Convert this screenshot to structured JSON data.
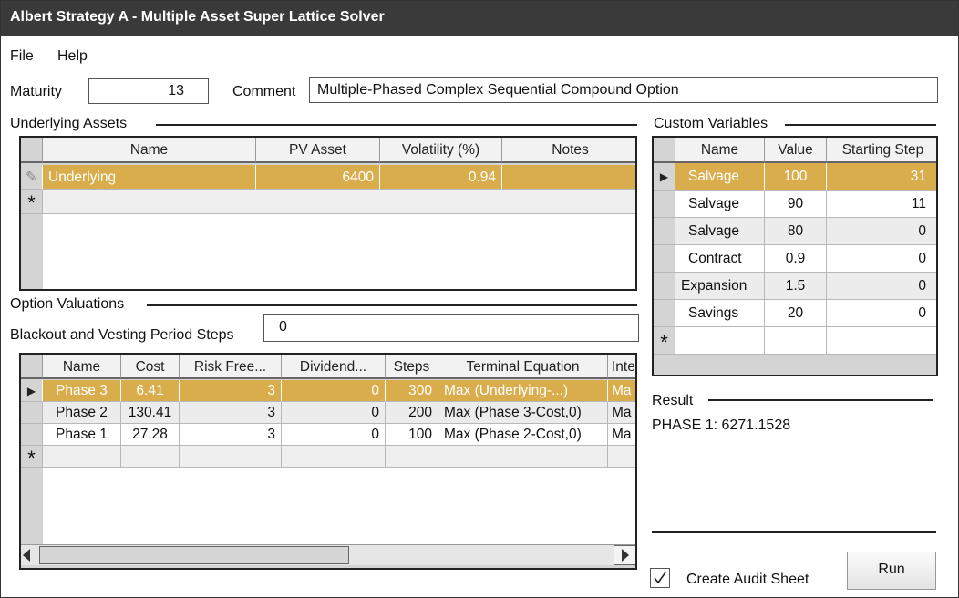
{
  "window": {
    "title": "Albert Strategy A - Multiple Asset Super Lattice Solver"
  },
  "menu": {
    "file": "File",
    "help": "Help"
  },
  "maturity": {
    "label": "Maturity",
    "value": "13"
  },
  "comment": {
    "label": "Comment",
    "value": "Multiple-Phased Complex Sequential Compound Option"
  },
  "underlying": {
    "title": "Underlying Assets",
    "headers": [
      "Name",
      "PV Asset",
      "Volatility (%)",
      "Notes"
    ],
    "rows": [
      {
        "name": "Underlying",
        "pv": "6400",
        "vol": "0.94",
        "notes": ""
      }
    ]
  },
  "custom": {
    "title": "Custom Variables",
    "headers": [
      "Name",
      "Value",
      "Starting Step"
    ],
    "rows": [
      {
        "name": "Salvage",
        "value": "100",
        "step": "31"
      },
      {
        "name": "Salvage",
        "value": "90",
        "step": "11"
      },
      {
        "name": "Salvage",
        "value": "80",
        "step": "0"
      },
      {
        "name": "Contract",
        "value": "0.9",
        "step": "0"
      },
      {
        "name": "Expansion",
        "value": "1.5",
        "step": "0"
      },
      {
        "name": "Savings",
        "value": "20",
        "step": "0"
      }
    ]
  },
  "options": {
    "title": "Option Valuations",
    "blackout_label": "Blackout and Vesting Period Steps",
    "blackout_value": "0",
    "headers": [
      "Name",
      "Cost",
      "Risk Free...",
      "Dividend...",
      "Steps",
      "Terminal Equation",
      "Inte"
    ],
    "rows": [
      {
        "name": "Phase 3",
        "cost": "6.41",
        "rf": "3",
        "div": "0",
        "steps": "300",
        "eq": "Max (Underlying-...)",
        "inte": "Ma"
      },
      {
        "name": "Phase 2",
        "cost": "130.41",
        "rf": "3",
        "div": "0",
        "steps": "200",
        "eq": "Max (Phase 3-Cost,0)",
        "inte": "Ma"
      },
      {
        "name": "Phase 1",
        "cost": "27.28",
        "rf": "3",
        "div": "0",
        "steps": "100",
        "eq": "Max (Phase 2-Cost,0)",
        "inte": "Ma"
      }
    ]
  },
  "result": {
    "label": "Result",
    "value": "PHASE 1: 6271.1528"
  },
  "audit": {
    "label": "Create Audit Sheet",
    "checked": true
  },
  "run": {
    "label": "Run"
  },
  "icons": {
    "new_row": "*",
    "current_row": "▶",
    "edit": "✎"
  },
  "colors": {
    "selection": "#d9ad4c",
    "titlebar": "#3a3a3a"
  }
}
